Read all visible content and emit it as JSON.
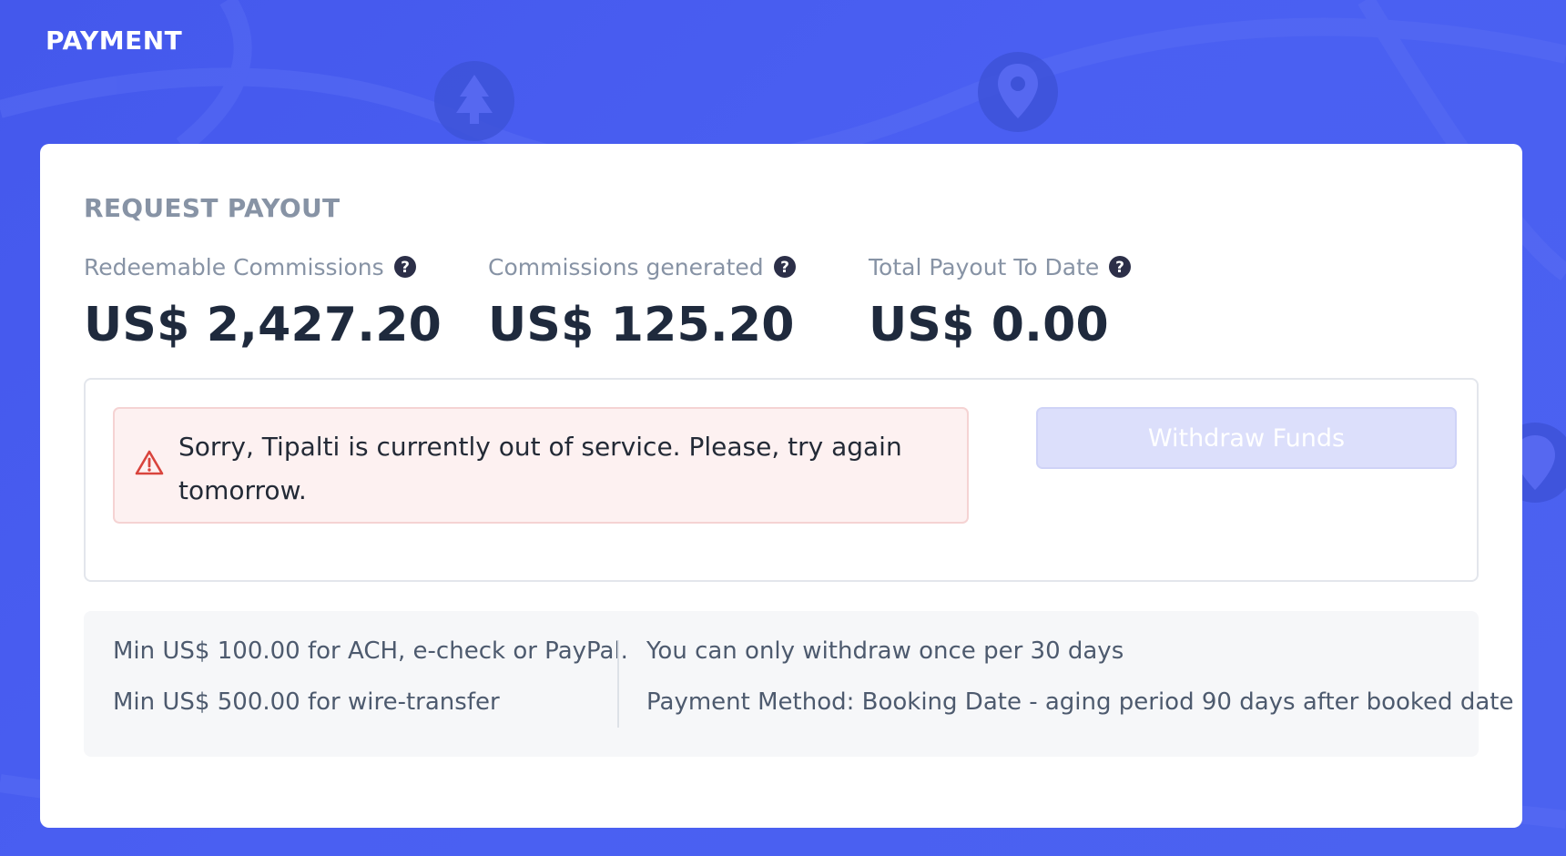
{
  "page": {
    "title": "PAYMENT"
  },
  "card": {
    "title": "REQUEST PAYOUT",
    "stats": [
      {
        "label": "Redeemable Commissions",
        "value": "US$ 2,427.20"
      },
      {
        "label": "Commissions generated",
        "value": "US$ 125.20"
      },
      {
        "label": "Total Payout To Date",
        "value": "US$ 0.00"
      }
    ],
    "alert": {
      "icon": "warning-triangle-icon",
      "text": "Sorry, Tipalti is currently out of service. Please, try again tomorrow."
    },
    "withdraw_button": {
      "label": "Withdraw Funds",
      "disabled": true
    },
    "info": {
      "left": [
        "Min US$ 100.00 for ACH, e-check or PayPal.",
        "Min US$ 500.00 for wire-transfer"
      ],
      "right": [
        "You can only withdraw once per 30 days",
        "Payment Method: Booking Date - aging period 90 days after booked date"
      ]
    }
  },
  "colors": {
    "background": "#4458ec",
    "card": "#ffffff",
    "muted_text": "#8793a5",
    "value_text": "#1f2a3d",
    "alert_bg": "#fdf1f1",
    "alert_icon": "#d9443d",
    "button_disabled": "#dcdffb",
    "help_icon": "#2c2f48"
  }
}
